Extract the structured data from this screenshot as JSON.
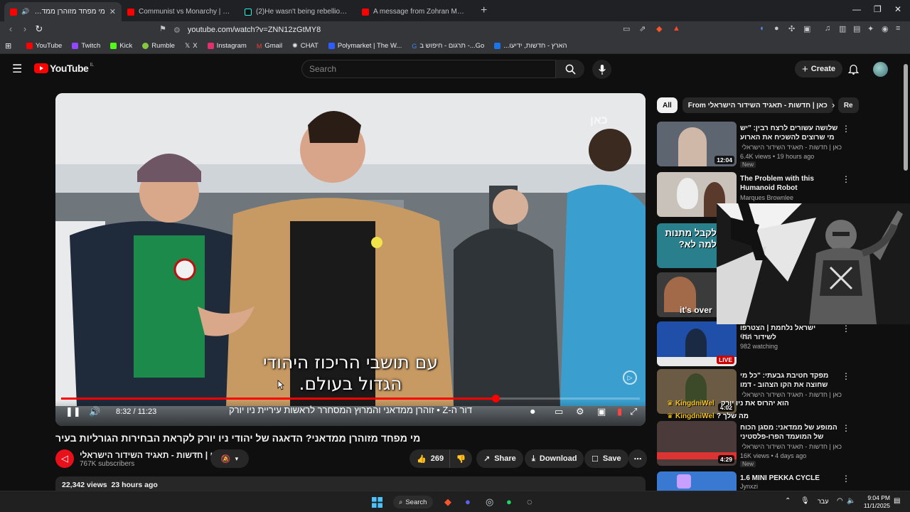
{
  "browser": {
    "tabs": [
      {
        "title": "מי מפחד מזוהרן ממדאני? הדא",
        "favicon": "youtube-icon",
        "active": true
      },
      {
        "title": "Communist vs Monarchy | Phonk Edi",
        "favicon": "youtube-icon",
        "active": false
      },
      {
        "title": "(2)He wasn't being rebellious, he was",
        "favicon": "tiktok-icon",
        "active": false
      },
      {
        "title": "A message from Zohran Mamdani - Y",
        "favicon": "youtube-icon",
        "active": false
      }
    ],
    "url": "youtube.com/watch?v=ZNN12zGtMY8",
    "bookmarks": [
      {
        "label": "YouTube",
        "color": "#ff0000"
      },
      {
        "label": "Twitch",
        "color": "#9146ff"
      },
      {
        "label": "Kick",
        "color": "#53fc18"
      },
      {
        "label": "Rumble",
        "color": "#85c742"
      },
      {
        "label": "X",
        "color": "#ffffff"
      },
      {
        "label": "Instagram",
        "color": "#e1306c"
      },
      {
        "label": "Gmail",
        "color": "#ea4335"
      },
      {
        "label": "CHAT",
        "color": "#cccccc"
      },
      {
        "label": "Polymarket | The W...",
        "color": "#2e5cff"
      },
      {
        "label": "Go...- תרגום - חיפוש ב",
        "color": "#4285f4"
      },
      {
        "label": "הארץ - חדשות, ידיעו...",
        "color": "#1a73e8"
      }
    ]
  },
  "youtube": {
    "logo_text": "YouTube",
    "region": "IL",
    "search_placeholder": "Search",
    "create_label": "Create"
  },
  "video": {
    "subtitle_line1": "עם תושבי הריכוז היהודי",
    "subtitle_line2": "הגדול בעולם.",
    "time": "8:32 / 11:23",
    "progress": 0.75,
    "chapter": "דור ה-Z • זוהרן ממדאני והמרוץ המסחרר לראשות עיריית ניו יורק",
    "watermark": "כאן",
    "title": "מי מפחד מזוהרן ממדאני? הדאגה של יהודי ניו יורק לקראת הבחירות הגורליות בעיר",
    "channel": "כאן | חדשות - תאגיד השידור הישראלי",
    "subscribers": "767K subscribers",
    "likes": "269",
    "share_label": "Share",
    "download_label": "Download",
    "save_label": "Save",
    "views": "22,342 views",
    "posted": "23 hours ago"
  },
  "sidebar": {
    "chips": [
      {
        "label": "All",
        "selected": true
      },
      {
        "label": "From כאן | חדשות - תאגיד השידור הישראלי",
        "selected": false
      },
      {
        "label": "Re",
        "selected": false
      }
    ],
    "recommendations": [
      {
        "title": "שלושה עשורים לרצח רבין: \"יש מי שרוצים להשכיח את הארוע הזה\"",
        "rtl": true,
        "channel": "כאן | חדשות - תאגיד השידור הישראלי",
        "meta": "6.4K views • 19 hours ago",
        "badge": "New",
        "duration": "12:04",
        "thumb_color": "#5d6670"
      },
      {
        "title": "The Problem with this Humanoid Robot",
        "rtl": false,
        "channel": "Marques Brownlee",
        "meta": "",
        "badge": "",
        "duration": "",
        "thumb_color": "#c8c2bb"
      },
      {
        "title": "",
        "rtl": false,
        "channel": "",
        "meta": "",
        "badge": "",
        "duration": "",
        "thumb_color": "#2a7f8c",
        "thumb_text": "לקבל מתנות למה לא?"
      },
      {
        "title": "",
        "rtl": false,
        "channel": "",
        "meta": "",
        "badge": "",
        "duration": "",
        "thumb_color": "#3b3b3b",
        "thumb_text": "it's over"
      },
      {
        "title": "ישראל נלחמת | הצטרפו לשידור החי",
        "rtl": true,
        "channel": "C14",
        "meta": "982 watching",
        "badge": "",
        "duration": "",
        "live": "LIVE",
        "thumb_color": "#1f4fa8"
      },
      {
        "title": "מפקד חטיבת גבעתי: \"כל מי שחוצה את הקו הצהוב - דמו בראשו\"",
        "rtl": true,
        "channel": "כאן | חדשות - תאגיד השידור הישראלי",
        "meta": "",
        "badge": "",
        "duration": "4:02",
        "thumb_color": "#6b5a44"
      },
      {
        "title": "המופע של ממדאני: מסגן הכוח של המועמד הפרו-פלסטיני לראשות ...",
        "rtl": true,
        "channel": "כאן | חדשות - תאגיד השידור הישראלי",
        "meta": "16K views • 4 days ago",
        "badge": "New",
        "duration": "4:29",
        "thumb_color": "#4a3a3a"
      },
      {
        "title": "1.6 MINI PEKKA CYCLE",
        "rtl": false,
        "channel": "Jynxzi",
        "meta": "",
        "badge": "",
        "duration": "",
        "thumb_color": "#3a79d1"
      }
    ]
  },
  "overlay": {
    "streamer_tag": "KingdniWel",
    "tag_text": "הוא יהרוס את ניו יורק",
    "tag_text2": "מה שלך ?"
  },
  "taskbar": {
    "search_label": "Search",
    "language": "עבר",
    "time": "9:04 PM",
    "date": "11/1/2025"
  }
}
